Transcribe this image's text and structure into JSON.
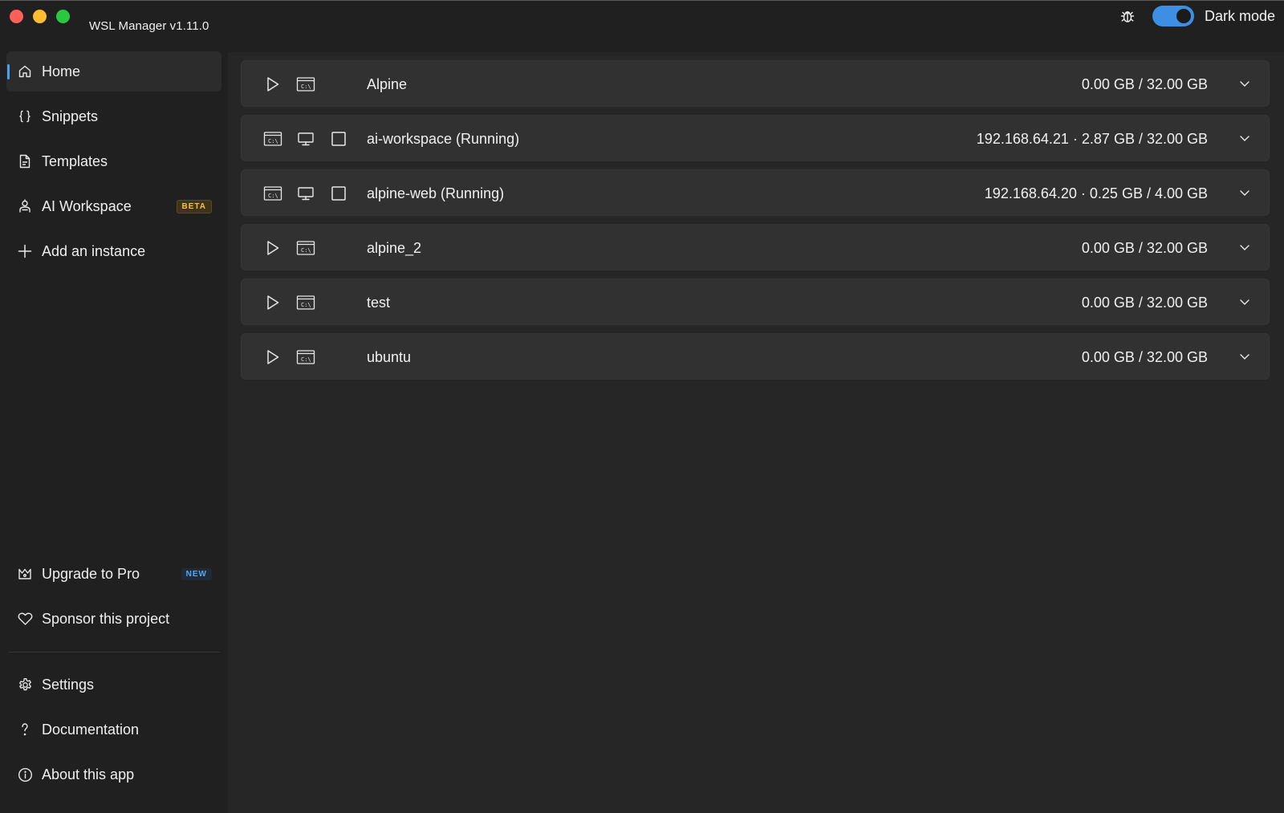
{
  "window": {
    "title": "WSL Manager v1.11.0"
  },
  "header": {
    "dark_mode_label": "Dark mode",
    "dark_mode_on": true
  },
  "sidebar": {
    "items": [
      {
        "label": "Home",
        "icon": "home-icon"
      },
      {
        "label": "Snippets",
        "icon": "braces-icon"
      },
      {
        "label": "Templates",
        "icon": "document-icon"
      },
      {
        "label": "AI Workspace",
        "icon": "person-robot-icon",
        "badge": "BETA"
      },
      {
        "label": "Add an instance",
        "icon": "plus-icon"
      }
    ],
    "bottom_items": [
      {
        "label": "Upgrade to Pro",
        "icon": "crown-icon",
        "badge": "NEW"
      },
      {
        "label": "Sponsor this project",
        "icon": "heart-icon"
      },
      {
        "label": "Settings",
        "icon": "gear-icon"
      },
      {
        "label": "Documentation",
        "icon": "question-icon"
      },
      {
        "label": "About this app",
        "icon": "info-icon"
      }
    ]
  },
  "instances": [
    {
      "name": "Alpine",
      "info": "0.00 GB / 32.00 GB",
      "running": false
    },
    {
      "name": "ai-workspace (Running)",
      "info": "192.168.64.21 · 2.87 GB / 32.00 GB",
      "running": true
    },
    {
      "name": "alpine-web (Running)",
      "info": "192.168.64.20 · 0.25 GB / 4.00 GB",
      "running": true
    },
    {
      "name": "alpine_2",
      "info": "0.00 GB / 32.00 GB",
      "running": false
    },
    {
      "name": "test",
      "info": "0.00 GB / 32.00 GB",
      "running": false
    },
    {
      "name": "ubuntu",
      "info": "0.00 GB / 32.00 GB",
      "running": false
    }
  ],
  "colors": {
    "accent": "#3c8fe3",
    "beta": "#f4c433",
    "new": "#5aa7ee"
  }
}
